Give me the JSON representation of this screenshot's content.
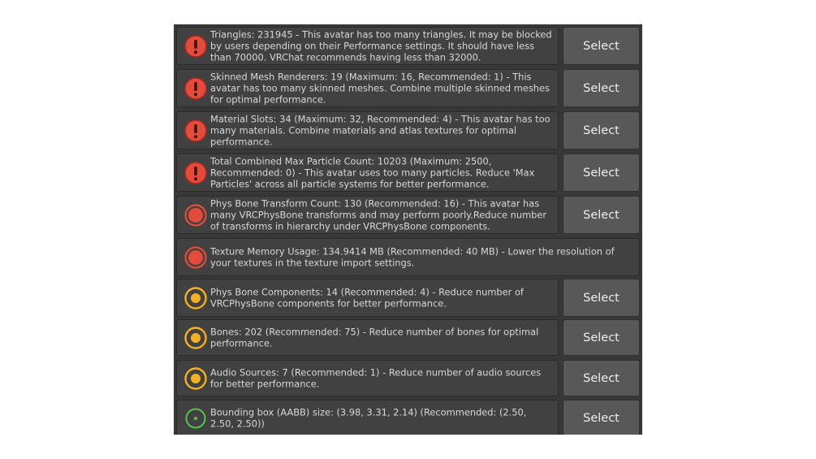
{
  "colors": {
    "error": "#e34c3c",
    "warning": "#f2b022",
    "info": "#55c24e",
    "panel": "#383838",
    "message_bg": "#414141",
    "button_bg": "#585858"
  },
  "items": [
    {
      "level": "error",
      "icon": "error-exclamation-icon",
      "text": "Triangles: 231945 - This avatar has too many triangles. It may be blocked by users depending on their Performance settings. It should have less than 70000. VRChat recommends having less than 32000.",
      "button": "Select"
    },
    {
      "level": "error",
      "icon": "error-exclamation-icon",
      "text": "Skinned Mesh Renderers: 19 (Maximum: 16, Recommended: 1) - This avatar has too many skinned meshes. Combine multiple skinned meshes for optimal performance.",
      "button": "Select"
    },
    {
      "level": "error",
      "icon": "error-exclamation-icon",
      "text": "Material Slots: 34 (Maximum: 32, Recommended: 4) - This avatar has too many materials. Combine materials and atlas textures for optimal performance.",
      "button": "Select"
    },
    {
      "level": "error",
      "icon": "error-exclamation-icon",
      "text": "Total Combined Max Particle Count: 10203 (Maximum: 2500, Recommended: 0) - This avatar uses too many particles. Reduce 'Max Particles' across all particle systems for better performance.",
      "button": "Select"
    },
    {
      "level": "poor",
      "icon": "poor-rating-icon",
      "text": "Phys Bone Transform Count: 130 (Recommended: 16) - This avatar has many VRCPhysBone transforms and may perform poorly.Reduce number of transforms in hierarchy under VRCPhysBone components.",
      "button": "Select"
    },
    {
      "level": "poor",
      "icon": "poor-rating-icon",
      "text": "Texture Memory Usage: 134.9414 MB (Recommended: 40 MB) - Lower the resolution of your textures in the texture import settings.",
      "button": ""
    },
    {
      "level": "medium",
      "icon": "medium-rating-icon",
      "text": "Phys Bone Components: 14 (Recommended: 4) - Reduce number of VRCPhysBone components for better performance.",
      "button": "Select"
    },
    {
      "level": "medium",
      "icon": "medium-rating-icon",
      "text": "Bones: 202 (Recommended: 75) - Reduce number of bones for optimal performance.",
      "button": "Select"
    },
    {
      "level": "medium",
      "icon": "medium-rating-icon",
      "text": "Audio Sources: 7 (Recommended: 1) - Reduce number of audio sources for better performance.",
      "button": "Select"
    },
    {
      "level": "good",
      "icon": "good-rating-icon",
      "text": "Bounding box (AABB) size: (3.98, 3.31, 2.14) (Recommended: (2.50, 2.50, 2.50))",
      "button": "Select"
    }
  ]
}
